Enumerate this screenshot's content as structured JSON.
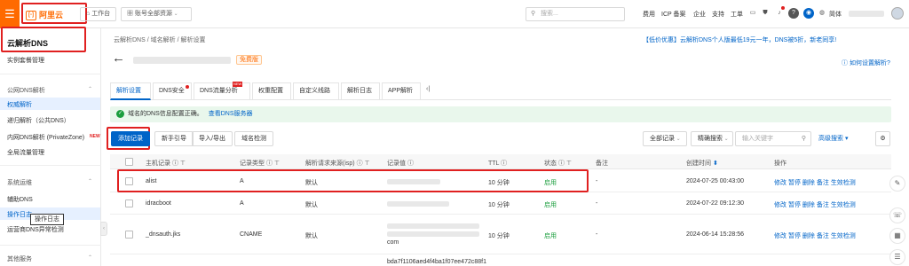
{
  "topbar": {
    "logo_text": "阿里云",
    "logo_mark": "[-]",
    "workbench": "工作台",
    "account_scope": "账号全部资源",
    "search_placeholder": "搜索...",
    "links": [
      "费用",
      "ICP 备案",
      "企业",
      "支持",
      "工单"
    ],
    "lang": "简体"
  },
  "sidebar": {
    "title": "云解析DNS",
    "instance_mgmt": "实例套餐管理",
    "public_dns": "公网DNS解析",
    "authoritative": "权威解析",
    "recursive": "递归解析（公共DNS）",
    "private_zone": "内网DNS解析 (PrivateZone)",
    "new_badge": "NEW",
    "global_traffic": "全局流量管理",
    "system_ops": "系统运维",
    "assist_dns": "辅助DNS",
    "op_log": "操作日志",
    "op_log_tooltip": "操作日志",
    "operator_abnormal": "运营商DNS异常检测",
    "other_services": "其他服务"
  },
  "header": {
    "breadcrumb": [
      "云解析DNS",
      "/",
      "域名解析",
      "/",
      "解析设置"
    ],
    "promo": "【低价优惠】云解析DNS个人版最低19元一年，DNS被5折，新老同享!",
    "free_badge": "免费版",
    "help_link": "如何设置解析?"
  },
  "tabs": [
    {
      "label": "解析设置",
      "selected": true
    },
    {
      "label": "DNS安全",
      "selected": false
    },
    {
      "label": "DNS流量分析",
      "selected": false,
      "badge": "NEW"
    },
    {
      "label": "权重配置",
      "selected": false
    },
    {
      "label": "自定义线路",
      "selected": false
    },
    {
      "label": "解析日志",
      "selected": false
    },
    {
      "label": "APP解析",
      "selected": false
    }
  ],
  "notice": {
    "text": "域名的DNS信息配置正确。",
    "link": "查看DNS服务器"
  },
  "toolbar": {
    "add": "添加记录",
    "guide": "新手引导",
    "import": "导入/导出",
    "check": "域名检测",
    "filter_all": "全部记录",
    "exact_search": "精确搜索",
    "keyword_placeholder": "输入关键字",
    "advanced": "高级搜索"
  },
  "table": {
    "headers": [
      "主机记录",
      "记录类型",
      "解析请求来源(isp)",
      "记录值",
      "TTL",
      "状态",
      "备注",
      "创建时间",
      "操作"
    ],
    "rows": [
      {
        "host": "alist",
        "type": "A",
        "isp": "默认",
        "value_tail": "",
        "ttl": "10 分钟",
        "status": "启用",
        "remark": "-",
        "created": "2024-07-25 00:43:00"
      },
      {
        "host": "idracboot",
        "type": "A",
        "isp": "默认",
        "value_tail": "",
        "ttl": "10 分钟",
        "status": "启用",
        "remark": "-",
        "created": "2024-07-22 09:12:30"
      },
      {
        "host": "_dnsauth.jks",
        "type": "CNAME",
        "isp": "默认",
        "value_tail": "com",
        "ttl": "10 分钟",
        "status": "启用",
        "remark": "-",
        "created": "2024-06-14 15:28:56"
      }
    ],
    "actions": [
      "修改",
      "暂停",
      "删除",
      "备注",
      "生效检测"
    ],
    "next_value": "bda7f1106aed4f4ba1f07ee472c88f1"
  }
}
